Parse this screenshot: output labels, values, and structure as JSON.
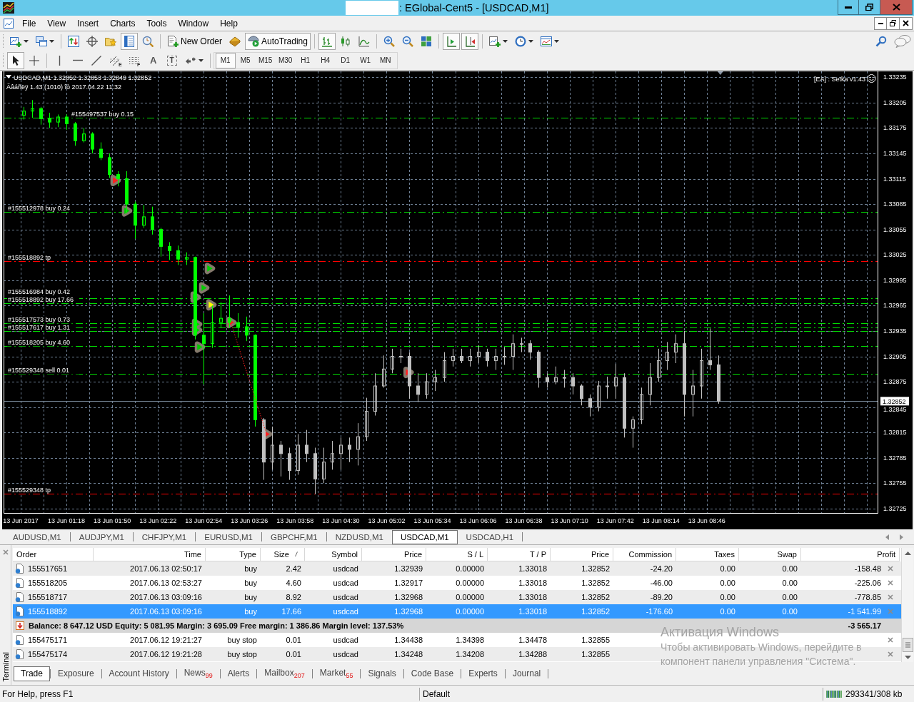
{
  "window": {
    "title": ": EGlobal-Cent5 - [USDCAD,M1]"
  },
  "menu": [
    "File",
    "View",
    "Insert",
    "Charts",
    "Tools",
    "Window",
    "Help"
  ],
  "toolbar": [
    {
      "pressed": false
    },
    {
      "pressed": false
    },
    {
      "pressed": false
    },
    {
      "pressed": false
    },
    {
      "pressed": false
    },
    {
      "pressed": true
    },
    {
      "pressed": false
    },
    {
      "label": "New Order",
      "pressed": false
    },
    {
      "pressed": false
    },
    {
      "label": "AutoTrading",
      "pressed": true
    },
    {
      "pressed": true
    },
    {
      "pressed": false
    },
    {
      "pressed": false
    },
    {
      "pressed": false
    },
    {
      "pressed": false
    },
    {
      "pressed": false
    },
    {
      "pressed": true
    },
    {
      "pressed": true
    },
    {
      "pressed": false
    },
    {
      "pressed": false
    },
    {
      "pressed": false
    }
  ],
  "drawing_tools": [
    {
      "pressed": true
    },
    {
      "pressed": false
    },
    {
      "pressed": false
    },
    {
      "pressed": false
    },
    {
      "pressed": false
    },
    {
      "sub": "E",
      "pressed": false
    },
    {
      "sub": "F",
      "pressed": false
    },
    {
      "glyph": "A",
      "pressed": false
    },
    {
      "glyph": "T",
      "pressed": false
    },
    {
      "pressed": false
    }
  ],
  "timeframes": [
    {
      "label": "M1",
      "selected": true
    },
    {
      "label": "M5",
      "selected": false
    },
    {
      "label": "M15",
      "selected": false
    },
    {
      "label": "M30",
      "selected": false
    },
    {
      "label": "H1",
      "selected": false
    },
    {
      "label": "H4",
      "selected": false
    },
    {
      "label": "D1",
      "selected": false
    },
    {
      "label": "W1",
      "selected": false
    },
    {
      "label": "MN",
      "selected": false
    }
  ],
  "chart": {
    "info": "USDCAD,M1 1.32852 1.32853 1.32849 1.32852",
    "expert": "Äâáñëÿ 1.43 (1010) îò 2017.04.22 11:32",
    "ea_label": "[EA] : Setka v1.43",
    "chart_data": [
      {
        "type": "candlestick",
        "xlim": [
          "2017-06-13T00:34",
          "2017-06-13T10:46"
        ],
        "ylim": [
          1.32719,
          1.33242
        ],
        "grid": true,
        "xticks": [
          {
            "value": "2017-06-13T00:46",
            "label": "13 Jun 2017"
          },
          {
            "value": "2017-06-13T01:18",
            "label": "13 Jun 01:18"
          },
          {
            "value": "2017-06-13T01:50",
            "label": "13 Jun 01:50"
          },
          {
            "value": "2017-06-13T02:22",
            "label": "13 Jun 02:22"
          },
          {
            "value": "2017-06-13T02:54",
            "label": "13 Jun 02:54"
          },
          {
            "value": "2017-06-13T03:26",
            "label": "13 Jun 03:26"
          },
          {
            "value": "2017-06-13T03:58",
            "label": "13 Jun 03:58"
          },
          {
            "value": "2017-06-13T04:30",
            "label": "13 Jun 04:30"
          },
          {
            "value": "2017-06-13T05:02",
            "label": "13 Jun 05:02"
          },
          {
            "value": "2017-06-13T05:34",
            "label": "13 Jun 05:34"
          },
          {
            "value": "2017-06-13T06:06",
            "label": "13 Jun 06:06"
          },
          {
            "value": "2017-06-13T06:38",
            "label": "13 Jun 06:38"
          },
          {
            "value": "2017-06-13T07:10",
            "label": "13 Jun 07:10"
          },
          {
            "value": "2017-06-13T07:42",
            "label": "13 Jun 07:42"
          },
          {
            "value": "2017-06-13T08:14",
            "label": "13 Jun 08:14"
          },
          {
            "value": "2017-06-13T08:46",
            "label": "13 Jun 08:46"
          }
        ],
        "yticks": [
          1.32725,
          1.32755,
          1.32785,
          1.32815,
          1.32845,
          1.32875,
          1.32905,
          1.32935,
          1.32965,
          1.32995,
          1.33025,
          1.33055,
          1.33085,
          1.33115,
          1.33145,
          1.33175,
          1.33205,
          1.33235
        ],
        "series": [
          {
            "type": "candlestick",
            "color": "#00ff00",
            "x": [
              "2017-06-13T00:48",
              "2017-06-13T00:54",
              "2017-06-13T01:00",
              "2017-06-13T01:06",
              "2017-06-13T01:12",
              "2017-06-13T01:18",
              "2017-06-13T01:24",
              "2017-06-13T01:30",
              "2017-06-13T01:36",
              "2017-06-13T01:42",
              "2017-06-13T01:48",
              "2017-06-13T01:54",
              "2017-06-13T02:00",
              "2017-06-13T02:06",
              "2017-06-13T02:12",
              "2017-06-13T02:18",
              "2017-06-13T02:24",
              "2017-06-13T02:30",
              "2017-06-13T02:36",
              "2017-06-13T02:42",
              "2017-06-13T02:48",
              "2017-06-13T02:54",
              "2017-06-13T03:00",
              "2017-06-13T03:06",
              "2017-06-13T03:12",
              "2017-06-13T03:18",
              "2017-06-13T03:24",
              "2017-06-13T03:30"
            ],
            "ohlc": [
              [
                1.3319,
                1.332,
                1.33185,
                1.33195
              ],
              [
                1.33195,
                1.33208,
                1.33187,
                1.33198
              ],
              [
                1.33198,
                1.332,
                1.33179,
                1.33186
              ],
              [
                1.33186,
                1.33193,
                1.33175,
                1.33182
              ],
              [
                1.33182,
                1.33191,
                1.33176,
                1.33188
              ],
              [
                1.33188,
                1.33191,
                1.33173,
                1.3318
              ],
              [
                1.3318,
                1.33182,
                1.33154,
                1.3316
              ],
              [
                1.3316,
                1.33175,
                1.33158,
                1.33168
              ],
              [
                1.33168,
                1.3317,
                1.33145,
                1.3315
              ],
              [
                1.3315,
                1.33158,
                1.33137,
                1.3314
              ],
              [
                1.3314,
                1.33145,
                1.33116,
                1.3312
              ],
              [
                1.3312,
                1.33124,
                1.33106,
                1.33115
              ],
              [
                1.33115,
                1.33124,
                1.33074,
                1.33085
              ],
              [
                1.33085,
                1.33088,
                1.33044,
                1.3306
              ],
              [
                1.3306,
                1.33084,
                1.33057,
                1.3307
              ],
              [
                1.3307,
                1.33082,
                1.33049,
                1.33055
              ],
              [
                1.33055,
                1.33057,
                1.33023,
                1.33035
              ],
              [
                1.33035,
                1.3304,
                1.33019,
                1.3303
              ],
              [
                1.3303,
                1.33036,
                1.33013,
                1.3302
              ],
              [
                1.3302,
                1.33028,
                1.33013,
                1.33022
              ],
              [
                1.33022,
                1.33023,
                1.32925,
                1.3293
              ],
              [
                1.3293,
                1.32956,
                1.32872,
                1.3292
              ],
              [
                1.3292,
                1.32965,
                1.32915,
                1.32945
              ],
              [
                1.32945,
                1.32969,
                1.32939,
                1.3295
              ],
              [
                1.3295,
                1.32977,
                1.32939,
                1.32945
              ],
              [
                1.32945,
                1.32956,
                1.32927,
                1.3294
              ],
              [
                1.3294,
                1.32952,
                1.32923,
                1.3293
              ],
              [
                1.3293,
                1.32931,
                1.32822,
                1.3283
              ]
            ]
          },
          {
            "type": "candlestick",
            "color": "#c0c0c0",
            "x": [
              "2017-06-13T03:36",
              "2017-06-13T03:42",
              "2017-06-13T03:48",
              "2017-06-13T03:54",
              "2017-06-13T04:00",
              "2017-06-13T04:06",
              "2017-06-13T04:12",
              "2017-06-13T04:18",
              "2017-06-13T04:24",
              "2017-06-13T04:30",
              "2017-06-13T04:36",
              "2017-06-13T04:42",
              "2017-06-13T04:48",
              "2017-06-13T04:54",
              "2017-06-13T05:00",
              "2017-06-13T05:06",
              "2017-06-13T05:12",
              "2017-06-13T05:18",
              "2017-06-13T05:24",
              "2017-06-13T05:30",
              "2017-06-13T05:36",
              "2017-06-13T05:42",
              "2017-06-13T05:48",
              "2017-06-13T05:54",
              "2017-06-13T06:00",
              "2017-06-13T06:06",
              "2017-06-13T06:12",
              "2017-06-13T06:18",
              "2017-06-13T06:24",
              "2017-06-13T06:30",
              "2017-06-13T06:36",
              "2017-06-13T06:42",
              "2017-06-13T06:48",
              "2017-06-13T06:54",
              "2017-06-13T07:00",
              "2017-06-13T07:06",
              "2017-06-13T07:12",
              "2017-06-13T07:18",
              "2017-06-13T07:24",
              "2017-06-13T07:30",
              "2017-06-13T07:36",
              "2017-06-13T07:42",
              "2017-06-13T07:48",
              "2017-06-13T07:54",
              "2017-06-13T08:00",
              "2017-06-13T08:06",
              "2017-06-13T08:12",
              "2017-06-13T08:18",
              "2017-06-13T08:24",
              "2017-06-13T08:30",
              "2017-06-13T08:36",
              "2017-06-13T08:42",
              "2017-06-13T08:48",
              "2017-06-13T08:54"
            ],
            "ohlc": [
              [
                1.3283,
                1.32832,
                1.32759,
                1.3278
              ],
              [
                1.3278,
                1.32822,
                1.32771,
                1.328
              ],
              [
                1.328,
                1.32805,
                1.32763,
                1.3279
              ],
              [
                1.3279,
                1.32797,
                1.32759,
                1.3277
              ],
              [
                1.3277,
                1.32813,
                1.32765,
                1.328
              ],
              [
                1.328,
                1.32818,
                1.3278,
                1.3279
              ],
              [
                1.3279,
                1.32797,
                1.32742,
                1.3276
              ],
              [
                1.3276,
                1.32797,
                1.32755,
                1.3278
              ],
              [
                1.3278,
                1.32805,
                1.32771,
                1.3279
              ],
              [
                1.3279,
                1.32809,
                1.32771,
                1.328
              ],
              [
                1.328,
                1.32809,
                1.3278,
                1.32795
              ],
              [
                1.32795,
                1.32826,
                1.32776,
                1.3281
              ],
              [
                1.3281,
                1.32856,
                1.32805,
                1.3284
              ],
              [
                1.3284,
                1.32885,
                1.32835,
                1.3287
              ],
              [
                1.3287,
                1.32906,
                1.32868,
                1.3289
              ],
              [
                1.3289,
                1.32914,
                1.32885,
                1.32905
              ],
              [
                1.32905,
                1.32914,
                1.32897,
                1.32905
              ],
              [
                1.32905,
                1.3291,
                1.32855,
                1.3287
              ],
              [
                1.3287,
                1.32885,
                1.32851,
                1.3286
              ],
              [
                1.3286,
                1.32885,
                1.32855,
                1.32875
              ],
              [
                1.32875,
                1.32889,
                1.32864,
                1.3288
              ],
              [
                1.3288,
                1.3291,
                1.32875,
                1.329
              ],
              [
                1.329,
                1.32914,
                1.32893,
                1.32905
              ],
              [
                1.32905,
                1.32914,
                1.32897,
                1.329
              ],
              [
                1.329,
                1.32914,
                1.32893,
                1.32905
              ],
              [
                1.32905,
                1.32918,
                1.32897,
                1.3291
              ],
              [
                1.3291,
                1.32914,
                1.32893,
                1.329
              ],
              [
                1.329,
                1.32914,
                1.32889,
                1.32905
              ],
              [
                1.32905,
                1.32916,
                1.32895,
                1.32905
              ],
              [
                1.32905,
                1.32931,
                1.32889,
                1.3292
              ],
              [
                1.3292,
                1.32927,
                1.3291,
                1.3292
              ],
              [
                1.3292,
                1.32924,
                1.32901,
                1.3291
              ],
              [
                1.3291,
                1.32912,
                1.32868,
                1.3288
              ],
              [
                1.3288,
                1.32885,
                1.32868,
                1.32875
              ],
              [
                1.32875,
                1.32893,
                1.32872,
                1.3288
              ],
              [
                1.3288,
                1.32889,
                1.32868,
                1.3288
              ],
              [
                1.3288,
                1.32885,
                1.3286,
                1.3287
              ],
              [
                1.3287,
                1.32872,
                1.32847,
                1.32855
              ],
              [
                1.32855,
                1.3286,
                1.32834,
                1.32845
              ],
              [
                1.32845,
                1.32876,
                1.3284,
                1.3287
              ],
              [
                1.3287,
                1.32881,
                1.32855,
                1.3287
              ],
              [
                1.3287,
                1.32896,
                1.32855,
                1.3288
              ],
              [
                1.3288,
                1.32885,
                1.32809,
                1.3282
              ],
              [
                1.3282,
                1.32834,
                1.32797,
                1.3283
              ],
              [
                1.3283,
                1.32868,
                1.32825,
                1.3286
              ],
              [
                1.3286,
                1.32897,
                1.32847,
                1.3288
              ],
              [
                1.3288,
                1.32914,
                1.32875,
                1.329
              ],
              [
                1.329,
                1.32922,
                1.32889,
                1.3291
              ],
              [
                1.3291,
                1.32931,
                1.32897,
                1.3292
              ],
              [
                1.3292,
                1.32935,
                1.32834,
                1.3286
              ],
              [
                1.3286,
                1.32889,
                1.32834,
                1.3287
              ],
              [
                1.3287,
                1.32914,
                1.32855,
                1.329
              ],
              [
                1.329,
                1.32938,
                1.32889,
                1.32895
              ],
              [
                1.32895,
                1.32906,
                1.32849,
                1.32852
              ]
            ]
          },
          {
            "type": "line",
            "color": "#ff2020",
            "line_style": "dotted",
            "marker": "triangle",
            "x": [
              "2017-06-13T03:13",
              "2017-06-13T03:38"
            ],
            "values": [
              1.32945,
              1.32813
            ]
          },
          {
            "type": "scatter",
            "color": "#ff2020",
            "marker": "triangle",
            "x": [
              "2017-06-13T01:52",
              "2017-06-13T05:17"
            ],
            "values": [
              1.33113,
              1.32886
            ]
          },
          {
            "type": "scatter",
            "color": "#00cc00",
            "marker": "triangle",
            "x": [
              "2017-06-13T02:00",
              "2017-06-13T02:58",
              "2017-06-13T02:54",
              "2017-06-13T02:48",
              "2017-06-13T02:49",
              "2017-06-13T02:49",
              "2017-06-13T02:51"
            ],
            "values": [
              1.33077,
              1.33009,
              1.32986,
              1.32975,
              1.32943,
              1.32936,
              1.32916
            ]
          },
          {
            "type": "scatter",
            "color": "#ffff00",
            "marker": "triangle",
            "x": [
              "2017-06-13T02:59"
            ],
            "values": [
              1.32966
            ]
          }
        ],
        "ref_lines": [
          {
            "axis": "y",
            "value": 1.33187,
            "label": "#155497537 buy 0.15",
            "color": "#00dd00",
            "line_style": "dashdot"
          },
          {
            "axis": "y",
            "value": 1.33076,
            "label": "#155512978 buy 0.24",
            "color": "#00dd00",
            "line_style": "dashdot"
          },
          {
            "axis": "y",
            "value": 1.33018,
            "label": "#155518892 tp",
            "color": "#ff0000",
            "line_style": "dashdot"
          },
          {
            "axis": "y",
            "value": 1.32974,
            "label": "#155516984 buy 0.42",
            "color": "#00dd00",
            "line_style": "dashdot"
          },
          {
            "axis": "y",
            "value": 1.32968,
            "label": "#155518892 buy 17.66",
            "color": "#00dd00",
            "line_style": "dashdot"
          },
          {
            "axis": "y",
            "value": 1.32944,
            "label": "#155517573 buy 0.73",
            "color": "#00dd00",
            "line_style": "dashdot"
          },
          {
            "axis": "y",
            "value": 1.32939,
            "color": "#00dd00",
            "line_style": "dashdot"
          },
          {
            "axis": "y",
            "value": 1.32935,
            "label": "#155517617 buy 1.31",
            "color": "#00dd00",
            "line_style": "dashdot"
          },
          {
            "axis": "y",
            "value": 1.32917,
            "label": "#155518205 buy 4.60",
            "color": "#00dd00",
            "line_style": "dashdot"
          },
          {
            "axis": "y",
            "value": 1.32884,
            "label": "#155529348 sell 0.01",
            "color": "#00dd00",
            "line_style": "dashdot"
          },
          {
            "axis": "y",
            "value": 1.32852,
            "label": "1.32852",
            "color": "#778899",
            "line_style": "solid"
          },
          {
            "axis": "y",
            "value": 1.32743,
            "label": "#155529348 tp",
            "color": "#ff0000",
            "line_style": "dashdot"
          }
        ]
      }
    ]
  },
  "chart_tabs": [
    {
      "label": "AUDUSD,M1",
      "selected": false
    },
    {
      "label": "AUDJPY,M1",
      "selected": false
    },
    {
      "label": "CHFJPY,M1",
      "selected": false
    },
    {
      "label": "EURUSD,M1",
      "selected": false
    },
    {
      "label": "GBPCHF,M1",
      "selected": false
    },
    {
      "label": "NZDUSD,M1",
      "selected": false
    },
    {
      "label": "USDCAD,M1",
      "selected": true
    },
    {
      "label": "USDCAD,H1",
      "selected": false
    }
  ],
  "terminal": {
    "label": "Terminal",
    "columns": [
      {
        "label": "Order",
        "sorted": false
      },
      {
        "label": "Time",
        "sorted": false
      },
      {
        "label": "Type",
        "sorted": false
      },
      {
        "label": "Size",
        "sorted": true
      },
      {
        "label": "Symbol",
        "sorted": false
      },
      {
        "label": "Price",
        "sorted": false
      },
      {
        "label": "S / L",
        "sorted": false
      },
      {
        "label": "T / P",
        "sorted": false
      },
      {
        "label": "Price",
        "sorted": false
      },
      {
        "label": "Commission",
        "sorted": false
      },
      {
        "label": "Taxes",
        "sorted": false
      },
      {
        "label": "Swap",
        "sorted": false
      },
      {
        "label": "Profit",
        "sorted": false
      }
    ],
    "rows": [
      {
        "kind": "trade",
        "selected": false,
        "cells": [
          "155517651",
          "2017.06.13 02:50:17",
          "buy",
          "2.42",
          "usdcad",
          "1.32939",
          "0.00000",
          "1.33018",
          "1.32852",
          "-24.20",
          "0.00",
          "0.00",
          "-158.48"
        ]
      },
      {
        "kind": "trade",
        "selected": false,
        "cells": [
          "155518205",
          "2017.06.13 02:53:27",
          "buy",
          "4.60",
          "usdcad",
          "1.32917",
          "0.00000",
          "1.33018",
          "1.32852",
          "-46.00",
          "0.00",
          "0.00",
          "-225.06"
        ]
      },
      {
        "kind": "trade",
        "selected": false,
        "cells": [
          "155518717",
          "2017.06.13 03:09:16",
          "buy",
          "8.92",
          "usdcad",
          "1.32968",
          "0.00000",
          "1.33018",
          "1.32852",
          "-89.20",
          "0.00",
          "0.00",
          "-778.85"
        ]
      },
      {
        "kind": "trade",
        "selected": true,
        "cells": [
          "155518892",
          "2017.06.13 03:09:16",
          "buy",
          "17.66",
          "usdcad",
          "1.32968",
          "0.00000",
          "1.33018",
          "1.32852",
          "-176.60",
          "0.00",
          "0.00",
          "-1 541.99"
        ]
      },
      {
        "kind": "summary",
        "selected": false,
        "text": "Balance: 8 647.12 USD Equity: 5 081.95 Margin: 3 695.09 Free margin: 1 386.86 Margin level: 137.53%",
        "profit": "-3 565.17"
      },
      {
        "kind": "trade",
        "selected": false,
        "cells": [
          "155475171",
          "2017.06.12 19:21:27",
          "buy stop",
          "0.01",
          "usdcad",
          "1.34438",
          "1.34398",
          "1.34478",
          "1.32855"
        ]
      },
      {
        "kind": "trade",
        "selected": false,
        "cells": [
          "155475174",
          "2017.06.12 19:21:28",
          "buy stop",
          "0.01",
          "usdcad",
          "1.34248",
          "1.34208",
          "1.34288",
          "1.32855"
        ]
      }
    ],
    "tabs": [
      {
        "label": "Trade",
        "selected": true
      },
      {
        "label": "Exposure",
        "selected": false
      },
      {
        "label": "Account History",
        "selected": false
      },
      {
        "label": "News",
        "badge": "99",
        "selected": false
      },
      {
        "label": "Alerts",
        "selected": false
      },
      {
        "label": "Mailbox",
        "badge": "207",
        "selected": false
      },
      {
        "label": "Market",
        "badge": "55",
        "selected": false
      },
      {
        "label": "Signals",
        "selected": false
      },
      {
        "label": "Code Base",
        "selected": false
      },
      {
        "label": "Experts",
        "selected": false
      },
      {
        "label": "Journal",
        "selected": false
      }
    ]
  },
  "activation_notice": {
    "title": "Активация Windows",
    "text": "Чтобы активировать Windows, перейдите в компонент панели управления \"Система\"."
  },
  "status_bar": {
    "help": "For Help, press F1",
    "profile": "Default",
    "traffic": "293341/308 kb"
  }
}
